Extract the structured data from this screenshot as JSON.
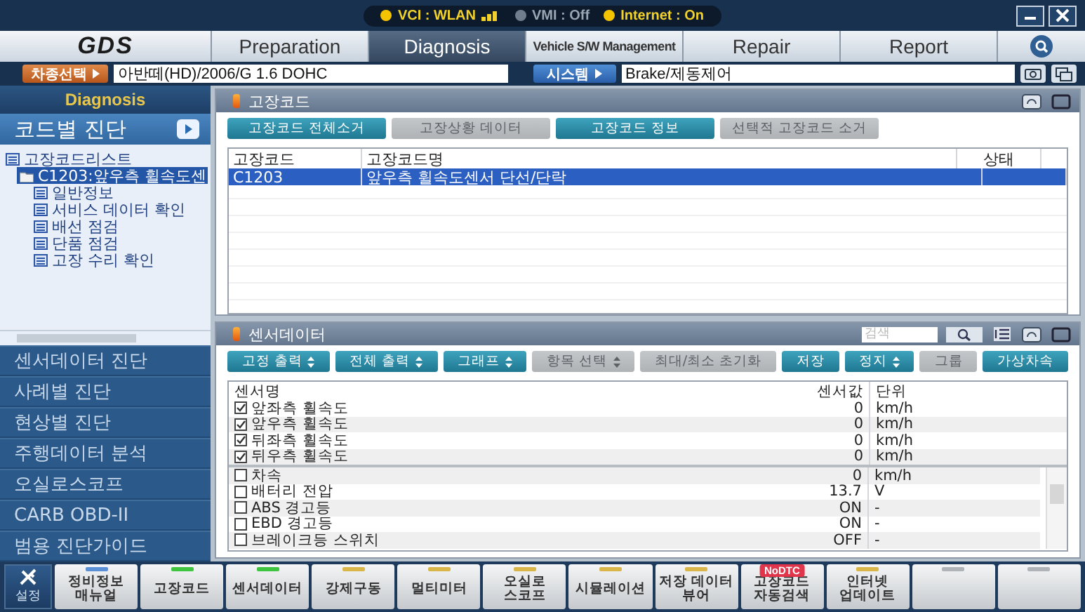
{
  "window": {
    "status": [
      {
        "label": "VCI : WLAN",
        "on": true,
        "kind": "wlan"
      },
      {
        "label": "VMI : Off",
        "on": false,
        "kind": "plain"
      },
      {
        "label": "Internet : On",
        "on": true,
        "kind": "plain"
      }
    ]
  },
  "logo": "GDS",
  "tabs": [
    {
      "label": "Preparation",
      "selected": false
    },
    {
      "label": "Diagnosis",
      "selected": true
    },
    {
      "label": "Vehicle S/W Management",
      "selected": false
    },
    {
      "label": "Repair",
      "selected": false
    },
    {
      "label": "Report",
      "selected": false
    }
  ],
  "vehicle_bar": {
    "vehicle_button": "차종선택",
    "vehicle": "아반떼(HD)/2006/G 1.6 DOHC",
    "system_button": "시스템",
    "system": "Brake/제동제어"
  },
  "sidebar": {
    "title": "Diagnosis",
    "top_item": {
      "label": "코드별 진단",
      "selected": true
    },
    "tree": [
      {
        "label": "고장코드리스트",
        "kind": "list",
        "selected": false,
        "children": [
          {
            "label": "C1203:앞우측 휠속도센",
            "kind": "folder",
            "selected": true,
            "children": [
              {
                "label": "일반정보",
                "kind": "list",
                "selected": false
              },
              {
                "label": "서비스 데이터 확인",
                "kind": "list",
                "selected": false
              },
              {
                "label": "배선 점검",
                "kind": "list",
                "selected": false
              },
              {
                "label": "단품 점검",
                "kind": "list",
                "selected": false
              },
              {
                "label": "고장 수리 확인",
                "kind": "list",
                "selected": false
              }
            ]
          }
        ]
      }
    ],
    "menu": [
      {
        "label": "센서데이터 진단",
        "selected": false
      },
      {
        "label": "사례별 진단",
        "selected": false
      },
      {
        "label": "현상별 진단",
        "selected": false
      },
      {
        "label": "주행데이터 분석",
        "selected": false
      },
      {
        "label": "오실로스코프",
        "selected": false
      },
      {
        "label": "CARB OBD-II",
        "selected": false
      },
      {
        "label": "범용 진단가이드",
        "selected": false
      }
    ]
  },
  "dtc_panel": {
    "title": "고장코드",
    "buttons": [
      {
        "label": "고장코드 전체소거",
        "disabled": false
      },
      {
        "label": "고장상황 데이터",
        "disabled": true
      },
      {
        "label": "고장코드 정보",
        "disabled": false
      },
      {
        "label": "선택적 고장코드 소거",
        "disabled": true
      }
    ],
    "table": {
      "columns": [
        "고장코드",
        "고장코드명",
        "상태"
      ],
      "rows": [
        {
          "cells": [
            "C1203",
            "앞우측 휠속도센서 단선/단락"
          ],
          "selected": true
        }
      ]
    }
  },
  "sensor_panel": {
    "title": "센서데이터",
    "search": {
      "placeholder": "검색"
    },
    "buttons": [
      {
        "label": "고정 출력",
        "dropdown": true,
        "disabled": false
      },
      {
        "label": "전체 출력",
        "dropdown": true,
        "disabled": false
      },
      {
        "label": "그래프",
        "dropdown": true,
        "disabled": false
      },
      {
        "label": "항목 선택",
        "dropdown": true,
        "disabled": true
      },
      {
        "label": "최대/최소 초기화",
        "dropdown": false,
        "disabled": true
      },
      {
        "label": "저장",
        "dropdown": false,
        "disabled": false
      },
      {
        "label": "정지",
        "dropdown": true,
        "disabled": false
      },
      {
        "label": "그룹",
        "dropdown": false,
        "disabled": true
      },
      {
        "label": "가상차속",
        "dropdown": false,
        "disabled": false
      }
    ],
    "table": {
      "columns": [
        "센서명",
        "센서값",
        "단위"
      ],
      "pinned_rows": [
        {
          "name": "앞좌측 휠속도",
          "value": "0",
          "unit": "km/h",
          "checked": true
        },
        {
          "name": "앞우측 휠속도",
          "value": "0",
          "unit": "km/h",
          "checked": true
        },
        {
          "name": "뒤좌측 휠속도",
          "value": "0",
          "unit": "km/h",
          "checked": true
        },
        {
          "name": "뒤우측 휠속도",
          "value": "0",
          "unit": "km/h",
          "checked": true
        }
      ],
      "rows": [
        {
          "name": "차속",
          "value": "0",
          "unit": "km/h",
          "checked": false
        },
        {
          "name": "배터리 전압",
          "value": "13.7",
          "unit": "V",
          "checked": false
        },
        {
          "name": "ABS 경고등",
          "value": "ON",
          "unit": "-",
          "checked": false
        },
        {
          "name": "EBD 경고등",
          "value": "ON",
          "unit": "-",
          "checked": false
        },
        {
          "name": "브레이크등 스위치",
          "value": "OFF",
          "unit": "-",
          "checked": false
        }
      ]
    }
  },
  "taskbar": {
    "settings": "설정",
    "items": [
      {
        "label": "정비정보\n매뉴얼",
        "color": "#5b8fd6"
      },
      {
        "label": "고장코드",
        "color": "#3ec43e"
      },
      {
        "label": "센서데이터",
        "color": "#3ec43e"
      },
      {
        "label": "강제구동",
        "color": "#d8b64a"
      },
      {
        "label": "멀티미터",
        "color": "#d8b64a"
      },
      {
        "label": "오실로\n스코프",
        "color": "#d8b64a"
      },
      {
        "label": "시뮬레이션",
        "color": "#d8b64a"
      },
      {
        "label": "저장 데이터\n뷰어",
        "color": "#d8b64a"
      },
      {
        "label": "고장코드\n자동검색",
        "badge": "NoDTC"
      },
      {
        "label": "인터넷\n업데이트",
        "color": "#d8b64a"
      },
      {
        "color": "#b0b4b8"
      },
      {
        "color": "#b0b4b8"
      }
    ]
  }
}
